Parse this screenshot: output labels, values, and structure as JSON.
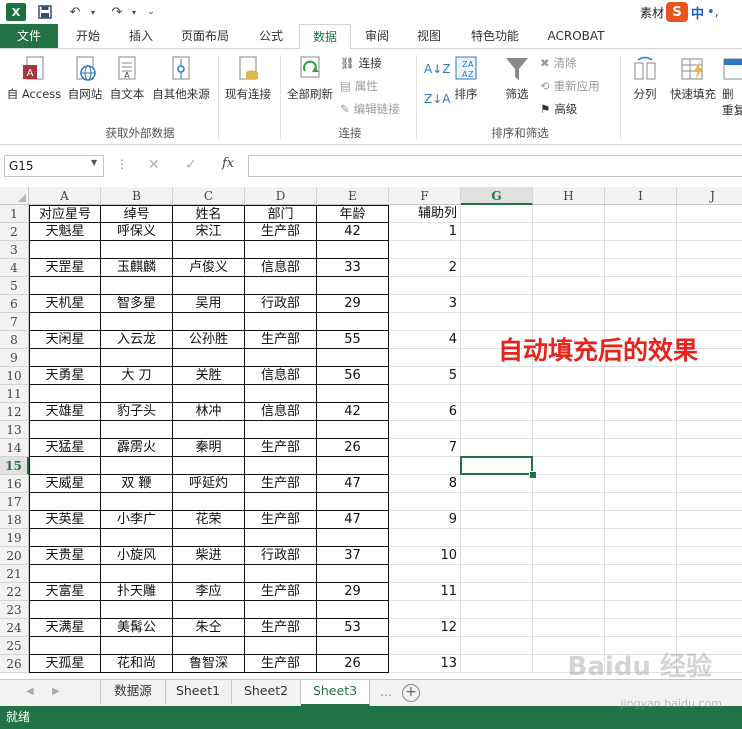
{
  "app": {
    "account_label": "素材",
    "ime_logo": "S",
    "ime_lang": "中",
    "ime_extra": "•,"
  },
  "ribbon_tabs": [
    "文件",
    "开始",
    "插入",
    "页面布局",
    "公式",
    "数据",
    "审阅",
    "视图",
    "特色功能",
    "ACROBAT"
  ],
  "ribbon": {
    "get_external": {
      "label": "获取外部数据",
      "from_access": "自 Access",
      "from_web": "自网站",
      "from_text": "自文本",
      "from_other": "自其他来源",
      "existing": "现有连接"
    },
    "connections": {
      "label": "连接",
      "refresh_all": "全部刷新",
      "connections": "连接",
      "properties": "属性",
      "edit_links": "编辑链接"
    },
    "sort_filter": {
      "label": "排序和筛选",
      "sort": "排序",
      "filter": "筛选",
      "clear": "清除",
      "reapply": "重新应用",
      "advanced": "高级"
    },
    "data_tools": {
      "text_to_columns": "分列",
      "flash_fill": "快速填充",
      "remove_dup_1": "删",
      "remove_dup_2": "重复"
    }
  },
  "formula_bar": {
    "name_box": "G15",
    "fx": "fx",
    "formula": ""
  },
  "columns": [
    "A",
    "B",
    "C",
    "D",
    "E",
    "F",
    "G",
    "H",
    "I",
    "J"
  ],
  "rows": [
    "1",
    "2",
    "3",
    "4",
    "5",
    "6",
    "7",
    "8",
    "9",
    "10",
    "11",
    "12",
    "13",
    "14",
    "15",
    "16",
    "17",
    "18",
    "19",
    "20",
    "21",
    "22",
    "23",
    "24",
    "25",
    "26"
  ],
  "table": {
    "headers": [
      "对应星号",
      "绰号",
      "姓名",
      "部门",
      "年龄",
      "辅助列"
    ],
    "records": [
      {
        "row": 2,
        "star": "天魁星",
        "nick": "呼保义",
        "name": "宋江",
        "dept": "生产部",
        "age": "42",
        "aux": "1"
      },
      {
        "row": 4,
        "star": "天罡星",
        "nick": "玉麒麟",
        "name": "卢俊义",
        "dept": "信息部",
        "age": "33",
        "aux": "2"
      },
      {
        "row": 6,
        "star": "天机星",
        "nick": "智多星",
        "name": "吴用",
        "dept": "行政部",
        "age": "29",
        "aux": "3"
      },
      {
        "row": 8,
        "star": "天闲星",
        "nick": "入云龙",
        "name": "公孙胜",
        "dept": "生产部",
        "age": "55",
        "aux": "4"
      },
      {
        "row": 10,
        "star": "天勇星",
        "nick": "大  刀",
        "name": "关胜",
        "dept": "信息部",
        "age": "56",
        "aux": "5"
      },
      {
        "row": 12,
        "star": "天雄星",
        "nick": "豹子头",
        "name": "林冲",
        "dept": "信息部",
        "age": "42",
        "aux": "6"
      },
      {
        "row": 14,
        "star": "天猛星",
        "nick": "霹雳火",
        "name": "秦明",
        "dept": "生产部",
        "age": "26",
        "aux": "7"
      },
      {
        "row": 16,
        "star": "天威星",
        "nick": "双  鞭",
        "name": "呼延灼",
        "dept": "生产部",
        "age": "47",
        "aux": "8"
      },
      {
        "row": 18,
        "star": "天英星",
        "nick": "小李广",
        "name": "花荣",
        "dept": "生产部",
        "age": "47",
        "aux": "9"
      },
      {
        "row": 20,
        "star": "天贵星",
        "nick": "小旋风",
        "name": "柴进",
        "dept": "行政部",
        "age": "37",
        "aux": "10"
      },
      {
        "row": 22,
        "star": "天富星",
        "nick": "扑天雕",
        "name": "李应",
        "dept": "生产部",
        "age": "29",
        "aux": "11"
      },
      {
        "row": 24,
        "star": "天满星",
        "nick": "美髯公",
        "name": "朱仝",
        "dept": "生产部",
        "age": "53",
        "aux": "12"
      },
      {
        "row": 26,
        "star": "天孤星",
        "nick": "花和尚",
        "name": "鲁智深",
        "dept": "生产部",
        "age": "26",
        "aux": "13"
      }
    ]
  },
  "annotation": "自动填充后的效果",
  "sheets": {
    "tabs": [
      "数据源",
      "Sheet1",
      "Sheet2",
      "Sheet3"
    ],
    "active": "Sheet3",
    "add": "+"
  },
  "status": {
    "text": "就绪"
  },
  "watermark": {
    "main": "Baidu 经验",
    "sub": "jingyan.baidu.com"
  },
  "colors": {
    "accent": "#217346",
    "annotation": "#e8231b"
  }
}
